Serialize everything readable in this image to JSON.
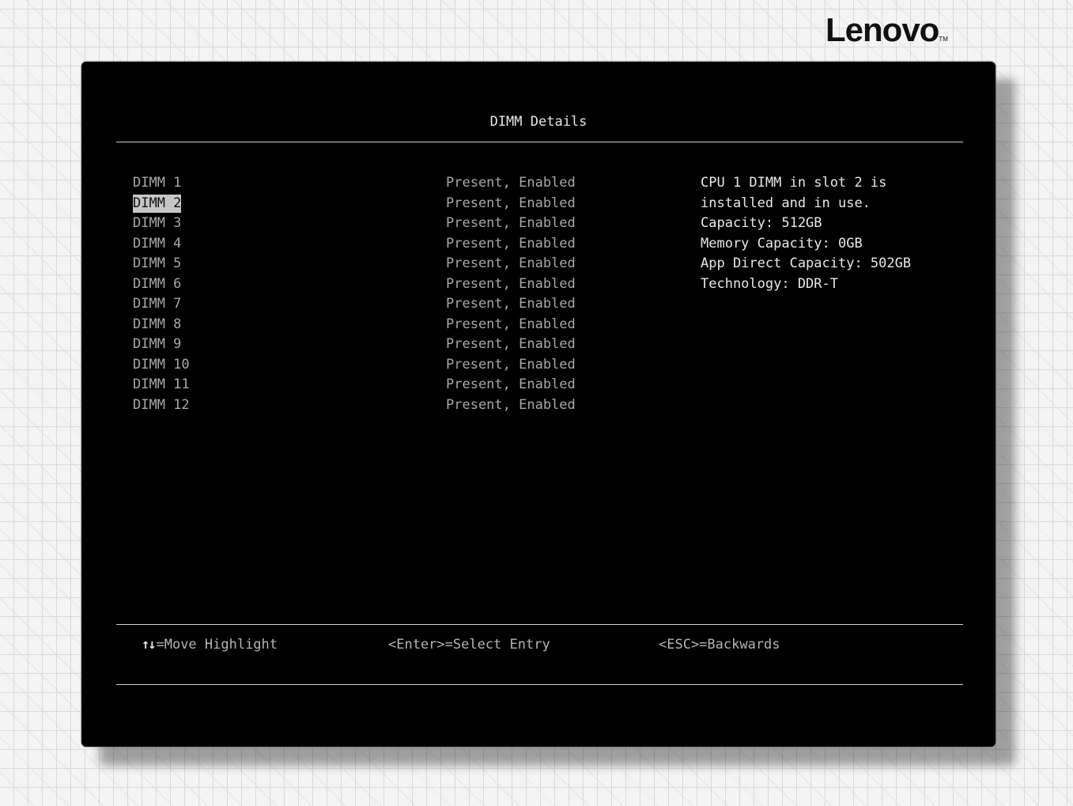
{
  "brand": {
    "logo_text": "Lenovo",
    "logo_tm": "TM"
  },
  "title": "DIMM Details",
  "dimms": [
    {
      "name": "DIMM 1",
      "status": "Present, Enabled",
      "selected": false
    },
    {
      "name": "DIMM 2",
      "status": "Present, Enabled",
      "selected": true
    },
    {
      "name": "DIMM 3",
      "status": "Present, Enabled",
      "selected": false
    },
    {
      "name": "DIMM 4",
      "status": "Present, Enabled",
      "selected": false
    },
    {
      "name": "DIMM 5",
      "status": "Present, Enabled",
      "selected": false
    },
    {
      "name": "DIMM 6",
      "status": "Present, Enabled",
      "selected": false
    },
    {
      "name": "DIMM 7",
      "status": "Present, Enabled",
      "selected": false
    },
    {
      "name": "DIMM 8",
      "status": "Present, Enabled",
      "selected": false
    },
    {
      "name": "DIMM 9",
      "status": "Present, Enabled",
      "selected": false
    },
    {
      "name": "DIMM 10",
      "status": "Present, Enabled",
      "selected": false
    },
    {
      "name": "DIMM 11",
      "status": "Present, Enabled",
      "selected": false
    },
    {
      "name": "DIMM 12",
      "status": "Present, Enabled",
      "selected": false
    }
  ],
  "help_text": [
    "CPU 1 DIMM in slot 2 is",
    "installed and in use.",
    "Capacity: 512GB",
    "Memory Capacity: 0GB",
    "App Direct Capacity: 502GB",
    "Technology: DDR-T"
  ],
  "footer": {
    "arrows_icon": "↑↓",
    "move_label": "=Move Highlight",
    "enter_label": "<Enter>=Select Entry",
    "esc_label": "<ESC>=Backwards"
  },
  "colors": {
    "background": "#000000",
    "text": "#a8a8a8",
    "highlight_bg": "#c6c6c6",
    "help_text": "#e8e8e8"
  }
}
